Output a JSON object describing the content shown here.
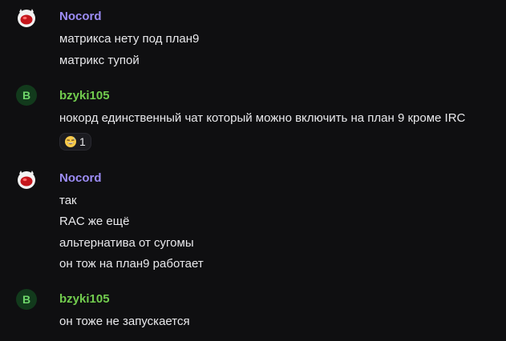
{
  "messages": [
    {
      "author": "Nocord",
      "avatar_icon": "glenda-bunny-icon",
      "lines": [
        "матрикса нету под план9",
        "матрикс тупой"
      ]
    },
    {
      "author": "bzyki105",
      "avatar_letter": "B",
      "lines": [
        "нокорд единственный чат который можно включить на план 9 кроме IRC"
      ],
      "reaction": {
        "emoji_icon": "grinning-sweat-emoji-icon",
        "count": "1"
      }
    },
    {
      "author": "Nocord",
      "avatar_icon": "glenda-bunny-icon",
      "lines": [
        "так",
        "RAC же ещё",
        "альтернатива от сугомы",
        "он тож на план9 работает"
      ]
    },
    {
      "author": "bzyki105",
      "avatar_letter": "B",
      "lines": [
        "он тоже не запускается"
      ]
    }
  ],
  "colors": {
    "background": "#0f0f11",
    "nocord_name": "#9c8cf5",
    "bzyki_name": "#72cc4e",
    "text": "#e9e9ec"
  }
}
